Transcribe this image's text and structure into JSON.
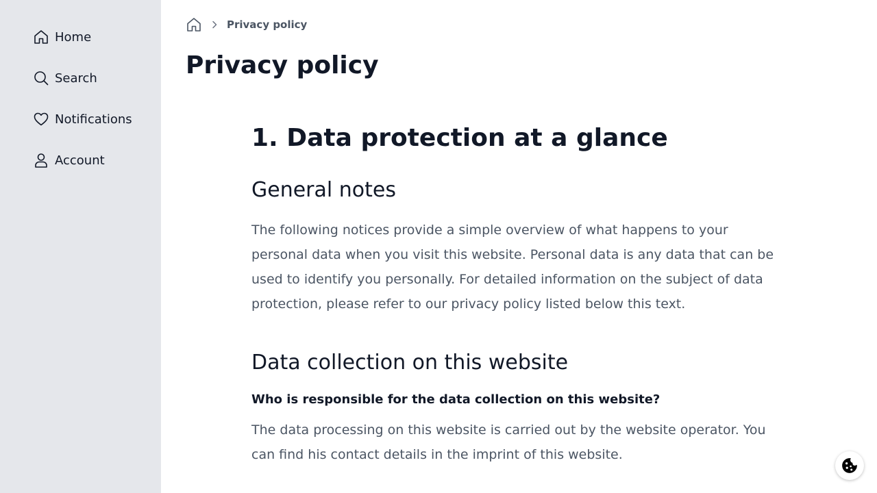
{
  "sidebar": {
    "items": [
      {
        "label": "Home",
        "icon": "home-icon"
      },
      {
        "label": "Search",
        "icon": "search-icon"
      },
      {
        "label": "Notifications",
        "icon": "heart-icon"
      },
      {
        "label": "Account",
        "icon": "user-icon"
      }
    ]
  },
  "breadcrumb": {
    "home_icon": "home-icon",
    "current": "Privacy policy"
  },
  "page": {
    "title": "Privacy policy"
  },
  "content": {
    "h1": "1. Data protection at a glance",
    "section1": {
      "heading": "General notes",
      "text": "The following notices provide a simple overview of what happens to your personal data when you visit this website. Personal data is any data that can be used to identify you personally. For detailed information on the subject of data protection, please refer to our privacy policy listed below this text."
    },
    "section2": {
      "heading": "Data collection on this website",
      "subheading": "Who is responsible for the data collection on this website?",
      "text": "The data processing on this website is carried out by the website operator. You can find his contact details in the imprint of this website."
    }
  },
  "cookie_button": {
    "icon": "cookie-icon"
  },
  "colors": {
    "sidebar_bg": "#e5e7eb",
    "text_dark": "#111827",
    "text_muted": "#4b5563"
  }
}
